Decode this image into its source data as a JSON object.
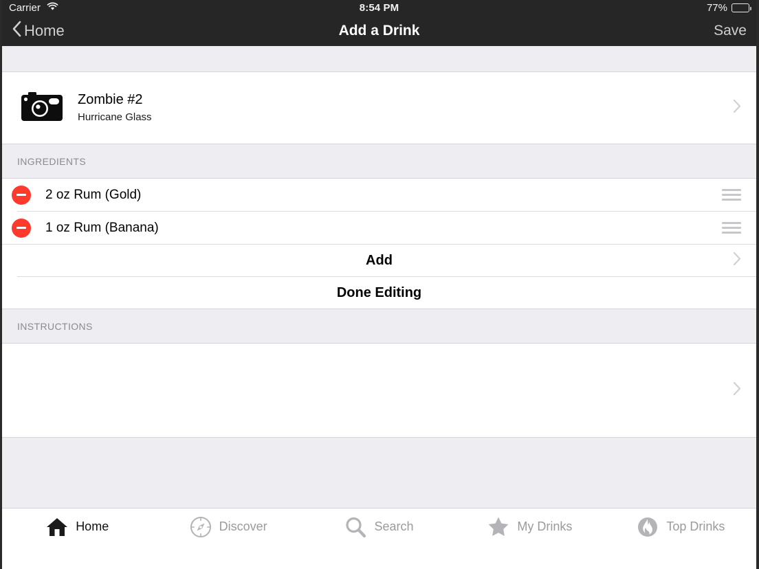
{
  "status_bar": {
    "carrier": "Carrier",
    "wifi_icon": "wifi-icon",
    "time": "8:54 PM",
    "battery_percent": "77%",
    "battery_level": 77,
    "battery_icon": "battery-icon"
  },
  "nav_bar": {
    "back_label": "Home",
    "back_icon": "chevron-left-icon",
    "title": "Add a Drink",
    "save_label": "Save"
  },
  "drink": {
    "photo_icon": "camera-icon",
    "name": "Zombie #2",
    "glass": "Hurricane Glass",
    "chevron_icon": "chevron-right-icon"
  },
  "ingredients_section": {
    "header": "INGREDIENTS",
    "items": [
      {
        "label": "2 oz Rum (Gold)",
        "delete_icon": "minus-circle-icon",
        "reorder_icon": "reorder-handle-icon"
      },
      {
        "label": "1 oz Rum (Banana)",
        "delete_icon": "minus-circle-icon",
        "reorder_icon": "reorder-handle-icon"
      }
    ],
    "add_label": "Add",
    "add_chevron_icon": "chevron-right-icon",
    "done_editing_label": "Done Editing"
  },
  "instructions_section": {
    "header": "INSTRUCTIONS",
    "value": "",
    "chevron_icon": "chevron-right-icon"
  },
  "tab_bar": {
    "items": [
      {
        "label": "Home",
        "icon": "home-icon",
        "active": true
      },
      {
        "label": "Discover",
        "icon": "compass-icon",
        "active": false
      },
      {
        "label": "Search",
        "icon": "search-icon",
        "active": false
      },
      {
        "label": "My Drinks",
        "icon": "star-icon",
        "active": false
      },
      {
        "label": "Top Drinks",
        "icon": "flame-icon",
        "active": false
      }
    ]
  },
  "colors": {
    "nav_background": "#262626",
    "section_background": "#eeeef2",
    "delete_red": "#fc3b2d",
    "inactive_tab": "#9a9a9f",
    "active_tab": "#111111"
  }
}
